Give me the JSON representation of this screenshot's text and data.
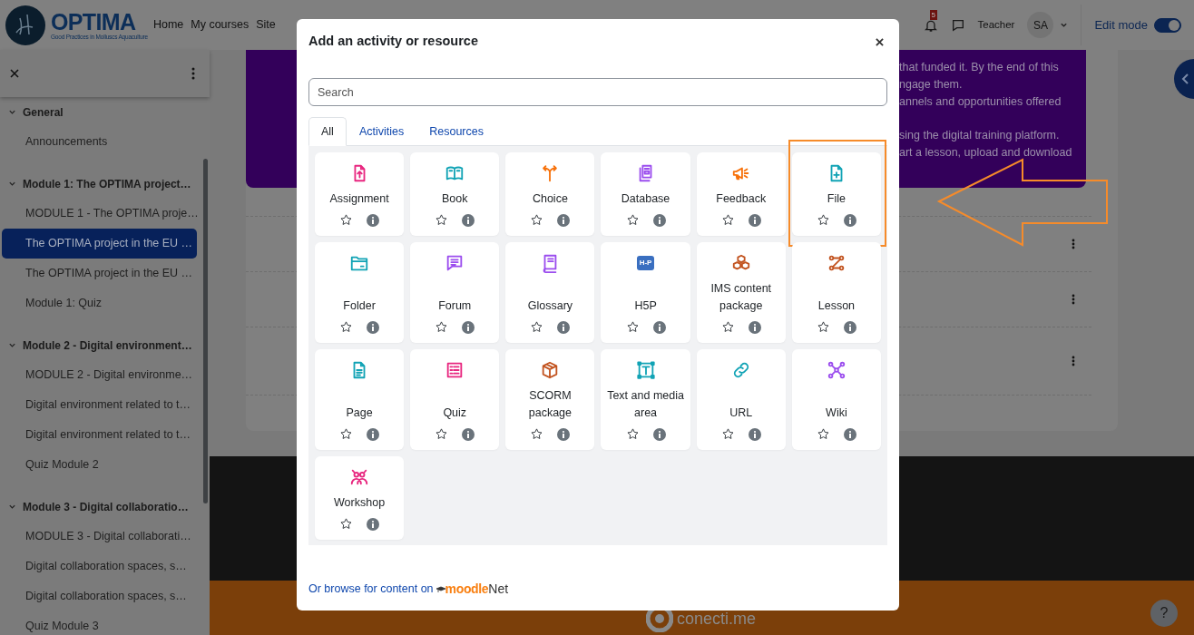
{
  "header": {
    "logo": {
      "title": "OPTIMA",
      "subtitle": "Good Practices in Molluscs Aquaculture"
    },
    "nav": [
      "Home",
      "My courses",
      "Site"
    ],
    "notifications_badge": "5",
    "user_role": "Teacher",
    "avatar": "SA",
    "edit_mode": {
      "label": "Edit mode",
      "on": true
    }
  },
  "sidebar": {
    "sections": [
      {
        "title": "General",
        "expanded": true,
        "items": [
          {
            "label": "Announcements",
            "selected": false
          }
        ]
      },
      {
        "title": "Module 1: The OPTIMA project…",
        "expanded": true,
        "items": [
          {
            "label": "MODULE 1 - The OPTIMA proje…",
            "selected": false
          },
          {
            "label": "The OPTIMA project in the EU …",
            "selected": true
          },
          {
            "label": "The OPTIMA project in the EU …",
            "selected": false
          },
          {
            "label": "Module 1: Quiz",
            "selected": false
          }
        ]
      },
      {
        "title": "Module 2 - Digital environment…",
        "expanded": true,
        "items": [
          {
            "label": "MODULE 2 - Digital environme…",
            "selected": false
          },
          {
            "label": "Digital environment related to t…",
            "selected": false
          },
          {
            "label": "Digital environment related to t…",
            "selected": false
          },
          {
            "label": "Quiz Module 2",
            "selected": false
          }
        ]
      },
      {
        "title": "Module 3 - Digital collaboratio…",
        "expanded": true,
        "items": [
          {
            "label": "MODULE 3 - Digital collaborati…",
            "selected": false
          },
          {
            "label": "Digital collaboration spaces, s…",
            "selected": false
          },
          {
            "label": "Digital collaboration spaces, s…",
            "selected": false
          },
          {
            "label": "Quiz Module 3",
            "selected": false
          }
        ]
      }
    ]
  },
  "course_card": {
    "paragraphs": [
      [
        "that funded it. By the end of this",
        "ngage them.",
        "annels and opportunities offered"
      ],
      [
        "sing the digital training platform.",
        "art a lesson, upload and download"
      ]
    ]
  },
  "modal": {
    "title": "Add an activity or resource",
    "search": {
      "placeholder": "Search"
    },
    "tabs": [
      {
        "label": "All",
        "selected": true
      },
      {
        "label": "Activities",
        "selected": false
      },
      {
        "label": "Resources",
        "selected": false
      }
    ],
    "items": [
      {
        "label": "Assignment",
        "color": "#e8267f",
        "starred": false,
        "highlighted": false
      },
      {
        "label": "Book",
        "color": "#11a3b5",
        "starred": false,
        "highlighted": false
      },
      {
        "label": "Choice",
        "color": "#f7710a",
        "starred": false,
        "highlighted": false
      },
      {
        "label": "Database",
        "color": "#9b4dee",
        "starred": false,
        "highlighted": false
      },
      {
        "label": "Feedback",
        "color": "#f7710a",
        "starred": false,
        "highlighted": false
      },
      {
        "label": "File",
        "color": "#11a3b5",
        "starred": false,
        "highlighted": true
      },
      {
        "label": "Folder",
        "color": "#11a3b5",
        "starred": false,
        "highlighted": false
      },
      {
        "label": "Forum",
        "color": "#9b4dee",
        "starred": false,
        "highlighted": false
      },
      {
        "label": "Glossary",
        "color": "#9b4dee",
        "starred": false,
        "highlighted": false
      },
      {
        "label": "H5P",
        "color": "#3a6fc0",
        "badge": "H-P",
        "starred": false,
        "highlighted": false
      },
      {
        "label": "IMS content package",
        "color": "#c2531f",
        "starred": false,
        "highlighted": false
      },
      {
        "label": "Lesson",
        "color": "#c2531f",
        "starred": false,
        "highlighted": false
      },
      {
        "label": "Page",
        "color": "#11a3b5",
        "starred": false,
        "highlighted": false
      },
      {
        "label": "Quiz",
        "color": "#e8267f",
        "starred": false,
        "highlighted": false
      },
      {
        "label": "SCORM package",
        "color": "#c2531f",
        "starred": false,
        "highlighted": false
      },
      {
        "label": "Text and media area",
        "color": "#11a3b5",
        "starred": false,
        "highlighted": false
      },
      {
        "label": "URL",
        "color": "#11a3b5",
        "starred": false,
        "highlighted": false
      },
      {
        "label": "Wiki",
        "color": "#9b4dee",
        "starred": false,
        "highlighted": false
      },
      {
        "label": "Workshop",
        "color": "#e8267f",
        "starred": false,
        "highlighted": false
      }
    ],
    "footer": {
      "link": "Or browse for content on",
      "logo": [
        "moodle",
        "Net"
      ]
    }
  },
  "footer": {
    "brand": "conecti.me",
    "help": "?"
  }
}
